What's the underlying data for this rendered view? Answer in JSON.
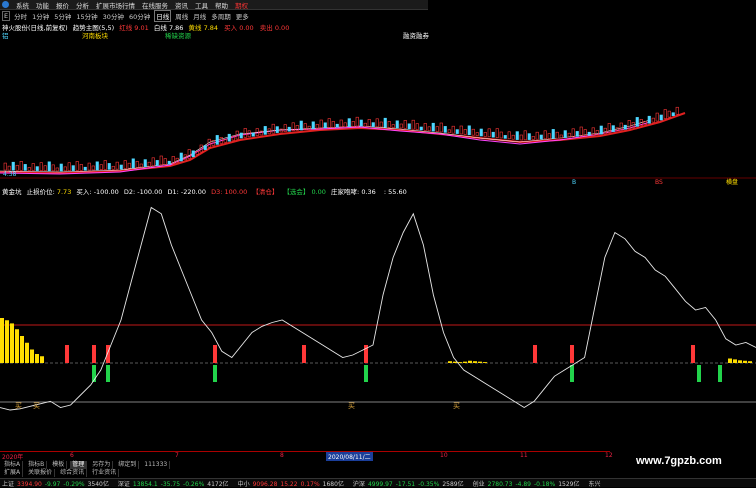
{
  "menubar": {
    "items": [
      "系统",
      "功能",
      "报价",
      "分析",
      "扩展市场行情",
      "在线服务",
      "资讯",
      "工具",
      "帮助"
    ],
    "highlight": "期权"
  },
  "periods": {
    "items": [
      "分时",
      "1分钟",
      "5分钟",
      "15分钟",
      "30分钟",
      "60分钟",
      "日线",
      "周线",
      "月线",
      "多周期",
      "更多"
    ],
    "selected": "日线",
    "edit_icon": "E"
  },
  "info_row": {
    "stock": "神火股份(日线,前复权)",
    "indicator": "趋势主图(5,5)",
    "red_label": "红线",
    "red_value": "9.01",
    "white_label": "白线",
    "white_value": "7.86",
    "yellow_label": "黄线",
    "yellow_value": "7.84",
    "buy_label": "买入",
    "buy_value": "0.00",
    "sell_label": "卖出",
    "sell_value": "0.00"
  },
  "label_row": {
    "left": "铝",
    "sector": "河南板块",
    "concept": "稀缺资源",
    "right": "融资融券"
  },
  "main_chart": {
    "markers": {
      "left": "B",
      "mid": "BS",
      "right": "横盘"
    },
    "low_tag": "4.38"
  },
  "osc_header": {
    "name": "黄金坑",
    "stop_label": "止损价位:",
    "stop_value": "7.73",
    "buy_label": "买入:",
    "buy_value": "-100.00",
    "d2_label": "D2:",
    "d2_value": "-100.00",
    "d1_label": "D1:",
    "d1_value": "-220.00",
    "d3_label": "D3:",
    "d3_value": "100.00",
    "tag1": "【清仓】",
    "tag2": "【选会】",
    "tag2_value": "0.00",
    "dealer_label": "庄家咆哮:",
    "dealer_value": "0.36",
    "last_value": ": 55.60"
  },
  "buy_marks": [
    "买",
    "买",
    "买",
    "买"
  ],
  "date_strip": {
    "year": "2020年",
    "ticks": [
      "6",
      "7",
      "8",
      "9",
      "10",
      "11",
      "12"
    ],
    "cursor": "2020/08/11/二"
  },
  "tabs_row1": [
    "指标A",
    "指标B",
    "模板",
    "管理",
    "另存为",
    "绑定到",
    "111333"
  ],
  "tabs_row2": [
    "扩展A",
    "关联报价",
    "综合资讯",
    "行业资讯"
  ],
  "tabs_active": "管理",
  "ticker": [
    {
      "name": "上证",
      "value": "3394.90",
      "chg": "-9.97",
      "pct": "-0.29%",
      "vol": "3540亿"
    },
    {
      "name": "深证",
      "value": "13854.1",
      "chg": "-35.75",
      "pct": "-0.26%",
      "vol": "4172亿"
    },
    {
      "name": "中小",
      "value": "9096.28",
      "chg": "15.22",
      "pct": "0.17%",
      "vol": "1680亿"
    },
    {
      "name": "沪深",
      "value": "4999.97",
      "chg": "-17.51",
      "pct": "-0.35%",
      "vol": "2589亿"
    },
    {
      "name": "创业",
      "value": "2780.73",
      "chg": "-4.89",
      "pct": "-0.18%",
      "vol": "1529亿"
    },
    {
      "name": "东兴",
      "value": "",
      "chg": "",
      "pct": "",
      "vol": ""
    }
  ],
  "watermark": "www.7gpzb.com",
  "colors": {
    "red": "#ff3838",
    "green": "#22d34b",
    "yellow": "#ffde00",
    "cyan": "#4fd7ff",
    "magenta": "#ff44ff"
  },
  "chart_data": {
    "type": "line",
    "series": [
      {
        "values": [
          30,
          28,
          29,
          31,
          33,
          35,
          30,
          32,
          40,
          48,
          60,
          80,
          100,
          130,
          160,
          190,
          185,
          160,
          140,
          120,
          100,
          90,
          75,
          70,
          80,
          90,
          95,
          98,
          100,
          95,
          90,
          85,
          80,
          75,
          70,
          72,
          76,
          80,
          120,
          150,
          170,
          185,
          160,
          120,
          90,
          70,
          60,
          55,
          50,
          45,
          40,
          35,
          30,
          35,
          45,
          55,
          60,
          65,
          70,
          110,
          150,
          170,
          165,
          155,
          150,
          140,
          135,
          125,
          115,
          108,
          110,
          100,
          85,
          80,
          82,
          78
        ]
      }
    ],
    "hist_yellow_left": [
      100,
      95,
      88,
      75,
      60,
      45,
      30,
      20,
      15
    ],
    "hist_yellow_right": [
      4,
      3,
      2,
      3,
      5,
      4,
      3,
      2
    ],
    "hist_yellow_far_right": [
      10,
      8,
      6,
      5,
      4
    ],
    "red_sticks": [
      65,
      92,
      106,
      213,
      302,
      364,
      533,
      570,
      691
    ],
    "green_sticks": [
      92,
      106,
      213,
      364,
      570,
      697,
      718
    ],
    "reference_levels": {
      "upper": "top line",
      "zero": "dashed midline",
      "lower": "bottom line"
    }
  }
}
